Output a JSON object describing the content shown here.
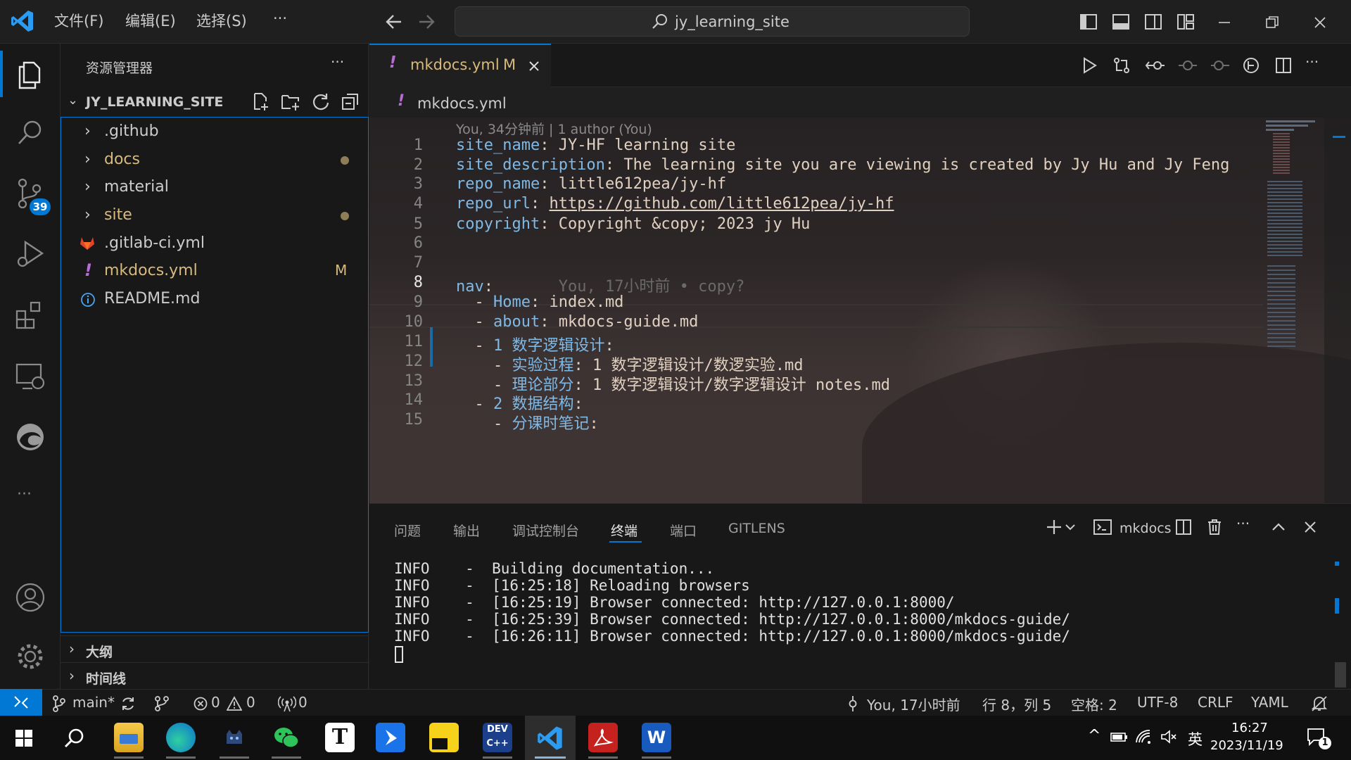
{
  "titlebar": {
    "menu": [
      "文件(F)",
      "编辑(E)",
      "选择(S)",
      "···"
    ],
    "search_text": "jy_learning_site"
  },
  "activity_bar": {
    "scm_badge": "39",
    "more": "···"
  },
  "sidebar": {
    "title": "资源管理器",
    "title_more": "···",
    "workspace": "JY_LEARNING_SITE",
    "items": [
      {
        "label": ".github",
        "kind": "folder",
        "dot": false
      },
      {
        "label": "docs",
        "kind": "folder",
        "dot": true
      },
      {
        "label": "material",
        "kind": "folder",
        "dot": false
      },
      {
        "label": "site",
        "kind": "folder",
        "dot": true
      },
      {
        "label": ".gitlab-ci.yml",
        "kind": "gitlab-file"
      },
      {
        "label": "mkdocs.yml",
        "kind": "yaml-file",
        "badge": "M"
      },
      {
        "label": "README.md",
        "kind": "info-file"
      }
    ],
    "outline": "大纲",
    "timeline": "时间线"
  },
  "editor": {
    "tab": {
      "icon": "!",
      "label": "mkdocs.yml",
      "badge": "M"
    },
    "breadcrumb": {
      "icon": "!",
      "label": "mkdocs.yml"
    },
    "blame_header": "You, 34分钟前 | 1 author (You)",
    "lines": [
      {
        "n": "1",
        "key": "site_name",
        "value": "JY-HF learning site"
      },
      {
        "n": "2",
        "key": "site_description",
        "value": "The learning site you are viewing is created by Jy Hu and Jy Feng"
      },
      {
        "n": "3",
        "key": "repo_name",
        "value": "little612pea/jy-hf"
      },
      {
        "n": "4",
        "key": "repo_url",
        "value": "https://github.com/little612pea/jy-hf"
      },
      {
        "n": "5",
        "key": "copyright",
        "value": "Copyright &copy; 2023 jy Hu"
      },
      {
        "n": "6",
        "key": "",
        "value": ""
      },
      {
        "n": "7",
        "key": "",
        "value": ""
      },
      {
        "n": "8",
        "key": "nav",
        "value": "",
        "blame": "You, 17小时前 • copy?"
      },
      {
        "n": "9",
        "key": "  - Home",
        "value": "index.md"
      },
      {
        "n": "10",
        "key": "  - about",
        "value": "mkdocs-guide.md"
      },
      {
        "n": "11",
        "key": "  - 1 数字逻辑设计",
        "value": ""
      },
      {
        "n": "12",
        "key": "    - 实验过程",
        "value": "1 数字逻辑设计/数逻实验.md"
      },
      {
        "n": "13",
        "key": "    - 理论部分",
        "value": "1 数字逻辑设计/数字逻辑设计 notes.md"
      },
      {
        "n": "14",
        "key": "  - 2 数据结构",
        "value": ""
      },
      {
        "n": "15",
        "key": "    - 分课时笔记",
        "value": ""
      }
    ]
  },
  "panel": {
    "tabs": [
      "问题",
      "输出",
      "调试控制台",
      "终端",
      "端口",
      "GITLENS"
    ],
    "active_tab": "终端",
    "terminal_name": "mkdocs",
    "terminal_lines": [
      "INFO    -  Building documentation...",
      "INFO    -  [16:25:18] Reloading browsers",
      "INFO    -  [16:25:19] Browser connected: http://127.0.0.1:8000/",
      "INFO    -  [16:25:39] Browser connected: http://127.0.0.1:8000/mkdocs-guide/",
      "INFO    -  [16:26:11] Browser connected: http://127.0.0.1:8000/mkdocs-guide/"
    ]
  },
  "statusbar": {
    "branch": "main*",
    "errors": "0",
    "warnings": "0",
    "ports": "0",
    "blame": "You, 17小时前",
    "position": "行 8，列 5",
    "spaces": "空格: 2",
    "encoding": "UTF-8",
    "eol": "CRLF",
    "language": "YAML"
  },
  "taskbar": {
    "time": "16:27",
    "date": "2023/11/19",
    "ime": "英",
    "notifications": "1"
  },
  "colors": {
    "accent": "#0078d4",
    "yaml_key": "#7fb9e6",
    "yaml_value": "#e0d0c0",
    "modified": "#d7ba7d",
    "gitlab": "#e2432a",
    "yaml_icon": "#b86cd8"
  }
}
